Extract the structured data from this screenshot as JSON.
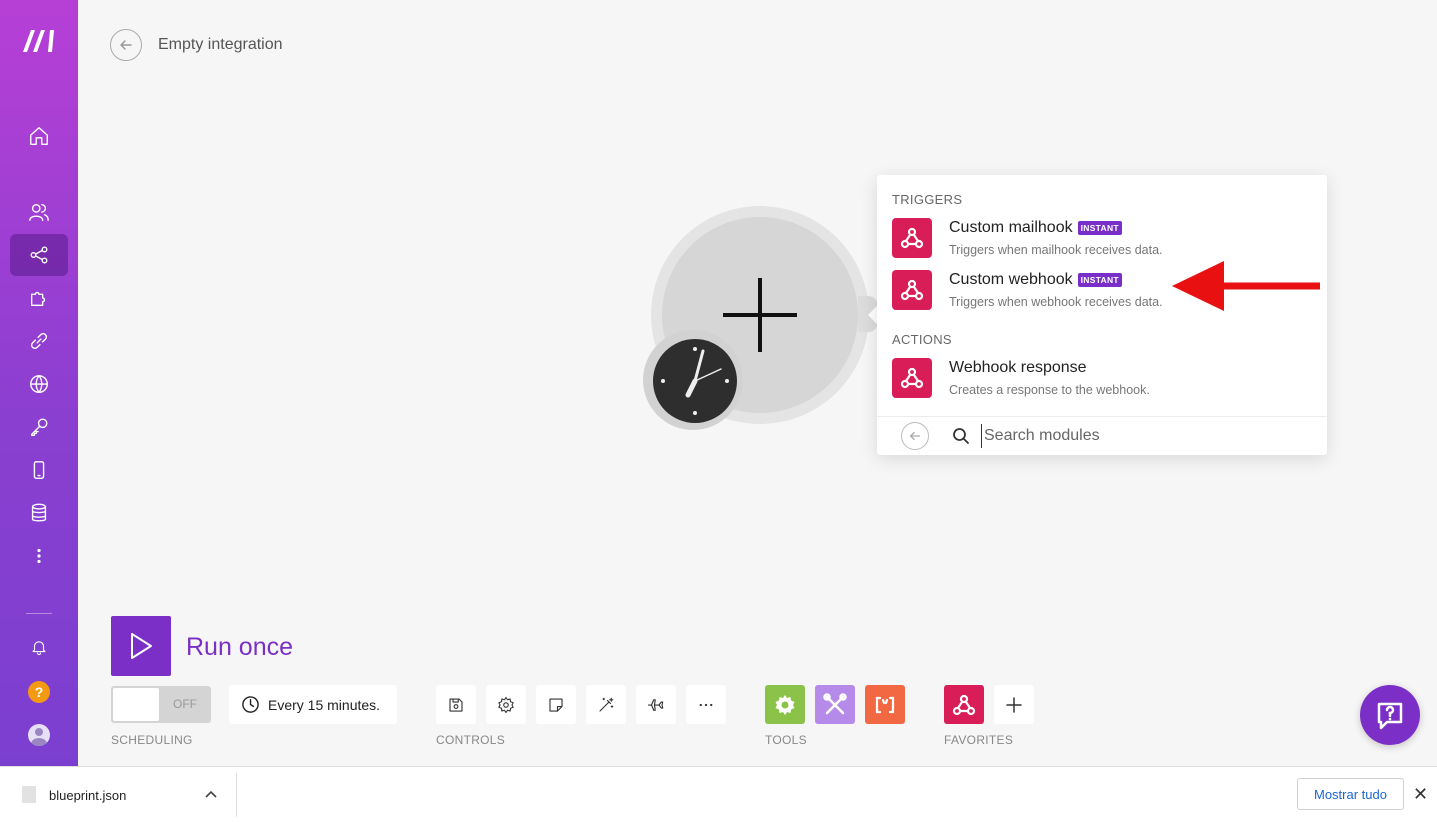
{
  "header": {
    "title": "Empty integration"
  },
  "sidebar": {
    "items": [
      {
        "icon": "home-icon"
      },
      {
        "icon": "team-icon"
      },
      {
        "icon": "scenarios-icon",
        "active": true
      },
      {
        "icon": "apps-icon"
      },
      {
        "icon": "connections-icon"
      },
      {
        "icon": "webhooks-icon"
      },
      {
        "icon": "keys-icon"
      },
      {
        "icon": "devices-icon"
      },
      {
        "icon": "datastores-icon"
      },
      {
        "icon": "more-icon"
      }
    ],
    "help_glyph": "?"
  },
  "popup": {
    "triggers_label": "TRIGGERS",
    "actions_label": "ACTIONS",
    "modules": [
      {
        "title": "Custom mailhook",
        "badge": "INSTANT",
        "desc": "Triggers when mailhook receives data."
      },
      {
        "title": "Custom webhook",
        "badge": "INSTANT",
        "desc": "Triggers when webhook receives data."
      },
      {
        "title": "Webhook response",
        "desc": "Creates a response to the webhook."
      }
    ],
    "search_placeholder": "Search modules"
  },
  "run": {
    "label": "Run once"
  },
  "toolbar": {
    "toggle_text": "OFF",
    "schedule_text": "Every 15 minutes.",
    "scheduling_label": "SCHEDULING",
    "controls_label": "CONTROLS",
    "tools_label": "TOOLS",
    "favorites_label": "FAVORITES",
    "colors": {
      "tools_green": "#8bc34a",
      "tools_purple": "#b68ae8",
      "tools_orange": "#f26843",
      "webhook_pink": "#d91d58",
      "brand_purple": "#7b2fc6"
    }
  },
  "download_bar": {
    "file_name": "blueprint.json",
    "show_all": "Mostrar tudo",
    "close_glyph": "✕",
    "chevron_glyph": "^"
  }
}
